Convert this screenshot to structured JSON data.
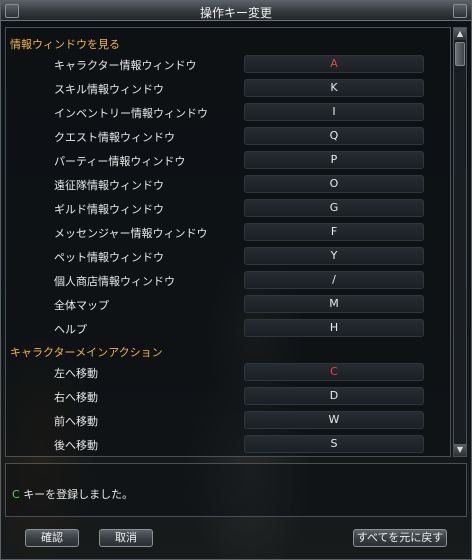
{
  "window": {
    "title": "操作キー変更"
  },
  "sections": [
    {
      "title": "情報ウィンドウを見る",
      "items": [
        {
          "label": "キャラクター情報ウィンドウ",
          "key": "A",
          "active": true
        },
        {
          "label": "スキル情報ウィンドウ",
          "key": "K",
          "active": false
        },
        {
          "label": "インベントリー情報ウィンドウ",
          "key": "I",
          "active": false
        },
        {
          "label": "クエスト情報ウィンドウ",
          "key": "Q",
          "active": false
        },
        {
          "label": "パーティー情報ウィンドウ",
          "key": "P",
          "active": false
        },
        {
          "label": "遠征隊情報ウィンドウ",
          "key": "O",
          "active": false
        },
        {
          "label": "ギルド情報ウィンドウ",
          "key": "G",
          "active": false
        },
        {
          "label": "メッセンジャー情報ウィンドウ",
          "key": "F",
          "active": false
        },
        {
          "label": "ペット情報ウィンドウ",
          "key": "Y",
          "active": false
        },
        {
          "label": "個人商店情報ウィンドウ",
          "key": "/",
          "active": false
        },
        {
          "label": "全体マップ",
          "key": "M",
          "active": false
        },
        {
          "label": "ヘルプ",
          "key": "H",
          "active": false
        }
      ]
    },
    {
      "title": "キャラクターメインアクション",
      "items": [
        {
          "label": "左へ移動",
          "key": "C",
          "active": true
        },
        {
          "label": "右へ移動",
          "key": "D",
          "active": false
        },
        {
          "label": "前へ移動",
          "key": "W",
          "active": false
        },
        {
          "label": "後へ移動",
          "key": "S",
          "active": false
        }
      ]
    }
  ],
  "status": {
    "key": "C",
    "message": "キーを登録しました。"
  },
  "buttons": {
    "ok": "確認",
    "cancel": "取消",
    "reset": "すべてを元に戻す"
  },
  "colors": {
    "section_title": "#f0b73a",
    "active_key": "#ff3a3a",
    "status_key": "#55d255"
  },
  "icons": {
    "scroll_up": "triangle-up-icon",
    "scroll_down": "triangle-down-icon"
  }
}
